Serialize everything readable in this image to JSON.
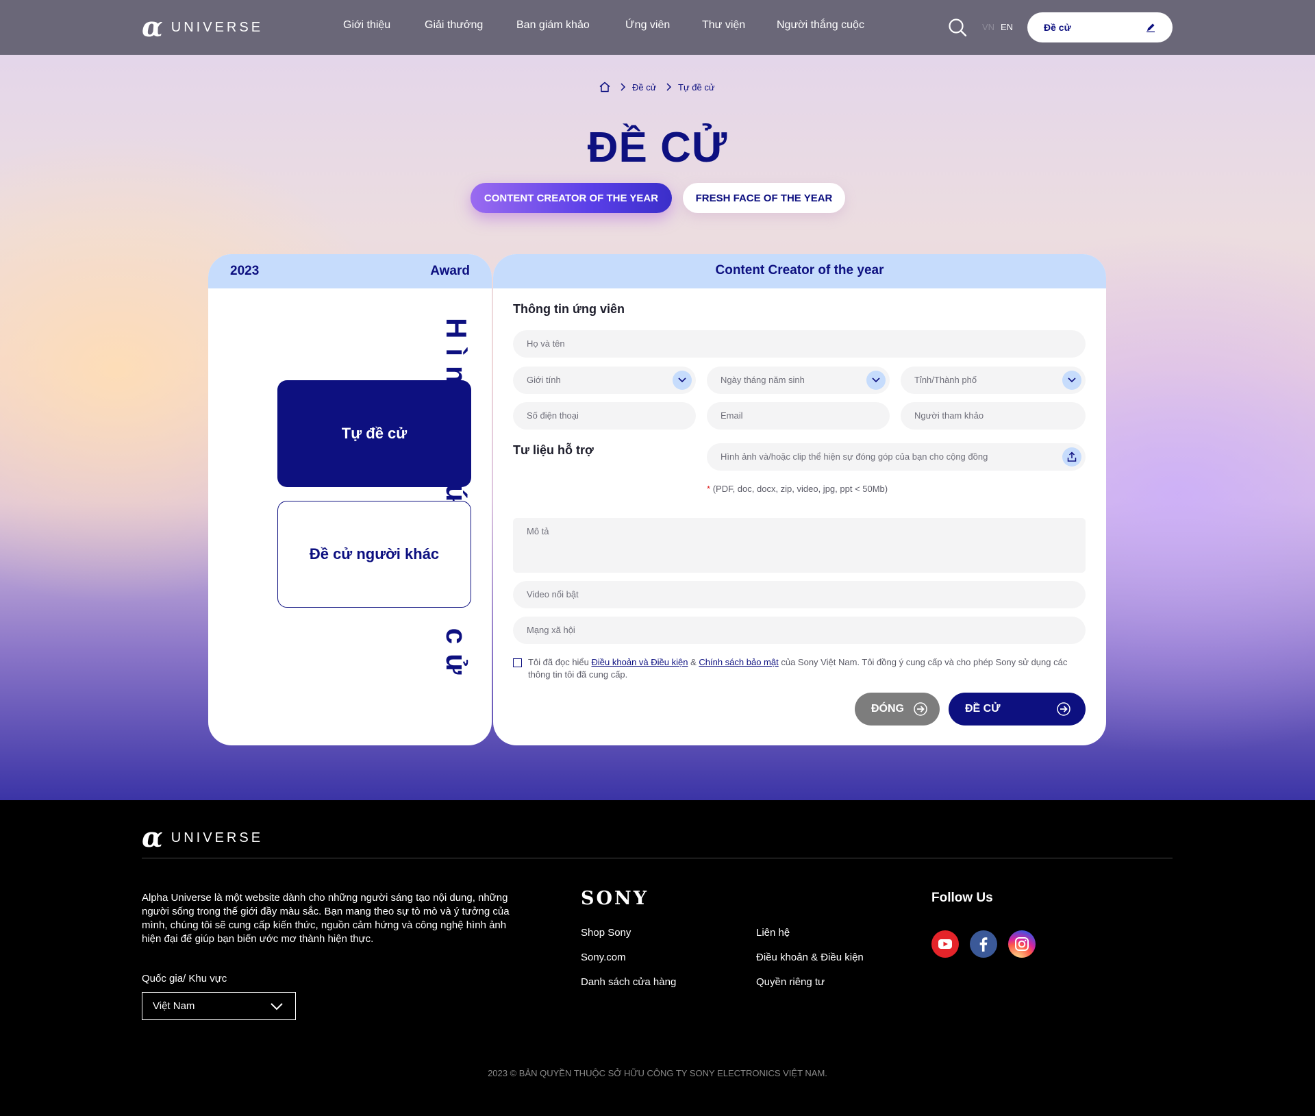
{
  "header": {
    "logo_text": "UNIVERSE",
    "nav": [
      "Giới thiệu",
      "Giải thưởng",
      "Ban giám khảo",
      "Ứng viên",
      "Thư viện",
      "Người thắng cuộc"
    ],
    "lang_vn": "VN",
    "lang_en": "EN",
    "nominate_button": "Đề cử"
  },
  "breadcrumb": [
    "Đề cử",
    "Tự đề cử"
  ],
  "page_title": "ĐỀ CỬ",
  "tabs": [
    "CONTENT CREATOR OF THE YEAR",
    "FRESH FACE OF THE YEAR"
  ],
  "left_panel": {
    "year": "2023",
    "award": "Award",
    "vertical_title": "Hình thức đề cử",
    "option_self": "Tự đề cử",
    "option_other": "Đề cử người khác"
  },
  "form": {
    "header": "Content Creator of the year",
    "candidate_section": "Thông tin ứng viên",
    "full_name": "Họ và tên",
    "gender": "Giới tính",
    "birthdate": "Ngày tháng năm sinh",
    "province": "Tỉnh/Thành phố",
    "phone": "Số điện thoại",
    "email": "Email",
    "referrer": "Người tham khảo",
    "support_section": "Tư liệu hỗ trợ",
    "upload": "Hình ảnh và/hoặc clip thể hiện sự đóng góp của bạn cho cộng đồng",
    "file_star": "*",
    "file_note": "(PDF, doc, docx, zip, video, jpg, ppt < 50Mb)",
    "description": "Mô tả",
    "featured_video": "Video nổi bật",
    "social_network": "Mạng xã hội",
    "agree_prefix": "Tôi đã đọc hiểu",
    "terms_link": "Điều khoản và Điều kiện",
    "agree_and": "&",
    "privacy_link": "Chính sách bảo mật",
    "agree_suffix": "của Sony Việt Nam. Tôi đồng ý cung cấp và cho phép Sony sử dụng các thông tin tôi đã cung cấp.",
    "close_button": "ĐÓNG",
    "submit_button": "ĐỀ CỬ"
  },
  "footer": {
    "logo_text": "UNIVERSE",
    "about": "Alpha Universe là một website dành cho những người sáng tạo nội dung, những người sống trong thế giới đầy màu sắc. Bạn mang theo sự tò mò và ý tưởng của mình, chúng tôi sẽ cung cấp kiến thức, nguồn cảm hứng và công nghệ hình ảnh hiện đại để giúp bạn biến ước mơ thành hiện thực.",
    "country_label": "Quốc gia/ Khu vực",
    "country_value": "Việt Nam",
    "sony": "SONY",
    "links_col1": [
      "Shop Sony",
      "Sony.com",
      "Danh sách cửa hàng"
    ],
    "links_col2": [
      "Liên hệ",
      "Điều khoản & Điều kiện",
      "Quyền riêng tư"
    ],
    "follow_us": "Follow Us",
    "copyright": "2023 © BẢN QUYỀN THUỘC SỞ HỮU CÔNG TY SONY ELECTRONICS VIỆT NAM."
  },
  "colors": {
    "brand_navy": "#0d1080",
    "header_bg": "#6a6778",
    "panel_header": "#c6dcfc"
  }
}
